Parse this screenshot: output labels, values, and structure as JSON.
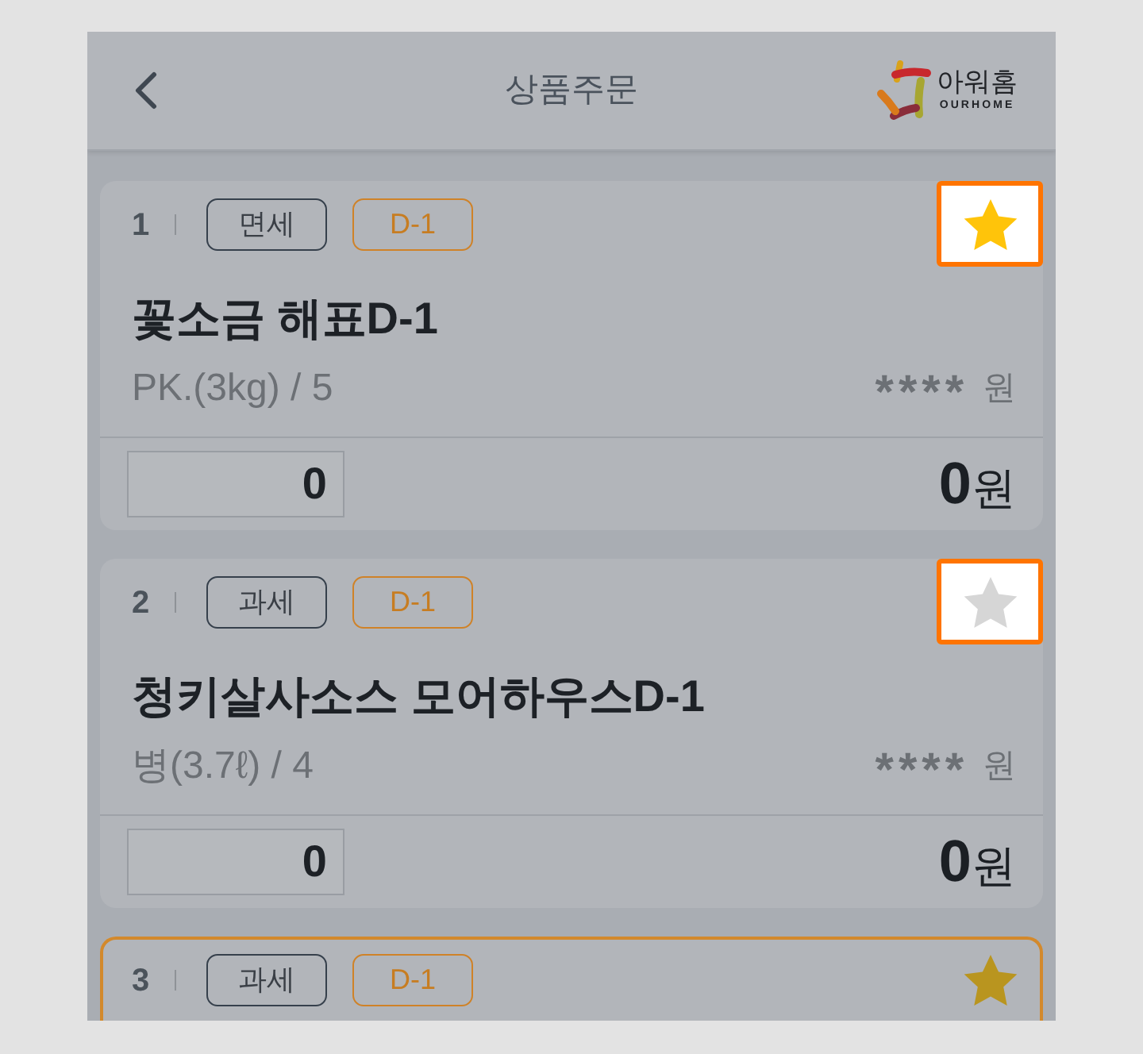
{
  "header": {
    "title": "상품주문",
    "logo_name": "아워홈",
    "logo_subtitle": "OURHOME"
  },
  "products": [
    {
      "number": "1",
      "tags": [
        {
          "label": "면세",
          "kind": "tax"
        },
        {
          "label": "D-1",
          "kind": "due"
        }
      ],
      "starred": true,
      "highlighted": true,
      "selected": false,
      "name": "꽃소금 해표D-1",
      "unit": "PK.(3kg) / 5",
      "price": "****",
      "price_currency": "원",
      "quantity": "0",
      "total": "0",
      "total_currency": "원"
    },
    {
      "number": "2",
      "tags": [
        {
          "label": "과세",
          "kind": "tax"
        },
        {
          "label": "D-1",
          "kind": "due"
        }
      ],
      "starred": false,
      "highlighted": true,
      "selected": false,
      "name": "청키살사소스 모어하우스D-1",
      "unit": "병(3.7ℓ) / 4",
      "price": "****",
      "price_currency": "원",
      "quantity": "0",
      "total": "0",
      "total_currency": "원"
    },
    {
      "number": "3",
      "tags": [
        {
          "label": "과세",
          "kind": "tax"
        },
        {
          "label": "D-1",
          "kind": "due"
        }
      ],
      "starred": true,
      "highlighted": false,
      "selected": true
    }
  ]
}
